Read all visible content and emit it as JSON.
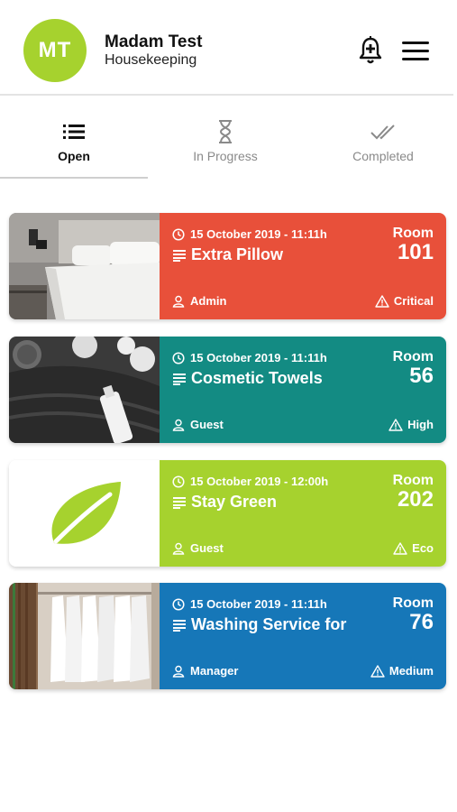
{
  "header": {
    "avatar_initials": "MT",
    "user_name": "Madam Test",
    "user_role": "Housekeeping",
    "notification_icon": "bell-plus-icon",
    "menu_icon": "hamburger-menu-icon"
  },
  "tabs": [
    {
      "label": "Open",
      "icon": "list-icon",
      "active": true
    },
    {
      "label": "In Progress",
      "icon": "hourglass-icon",
      "active": false
    },
    {
      "label": "Completed",
      "icon": "double-check-icon",
      "active": false
    }
  ],
  "requests": [
    {
      "date": "15 October 2019 - 11:11h",
      "title": "Extra Pillow",
      "user": "Admin",
      "room_label": "Room",
      "room": "101",
      "priority": "Critical",
      "color": "#e8503a",
      "thumb": "bed-photo"
    },
    {
      "date": "15 October 2019 - 11:11h",
      "title": "Cosmetic Towels",
      "user": "Guest",
      "room_label": "Room",
      "room": "56",
      "priority": "High",
      "color": "#138b83",
      "thumb": "towels-photo"
    },
    {
      "date": "15 October 2019 - 12:00h",
      "title": "Stay Green",
      "user": "Guest",
      "room_label": "Room",
      "room": "202",
      "priority": "Eco",
      "color": "#a6d22e",
      "thumb": "leaf-logo"
    },
    {
      "date": "15 October 2019 - 11:11h",
      "title": "Washing Service for",
      "user": "Manager",
      "room_label": "Room",
      "room": "76",
      "priority": "Medium",
      "color": "#1677b8",
      "thumb": "closet-photo"
    }
  ],
  "colors": {
    "brand_green": "#a6d22e",
    "critical": "#e8503a",
    "high": "#138b83",
    "eco": "#a6d22e",
    "medium": "#1677b8"
  }
}
